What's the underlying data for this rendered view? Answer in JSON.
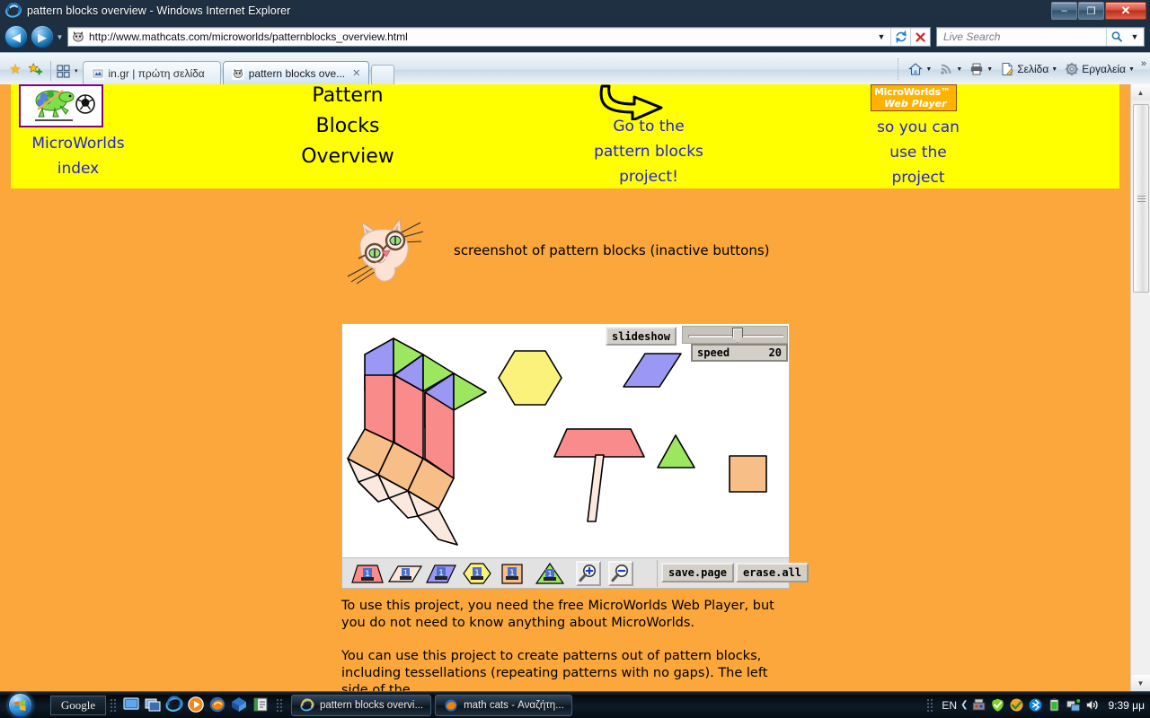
{
  "window": {
    "title": "pattern blocks overview - Windows Internet Explorer",
    "minimize_label": "–",
    "maximize_label": "❐",
    "close_label": "✕"
  },
  "navigation": {
    "back_label": "◀",
    "forward_label": "▶",
    "history_arrow": "▼",
    "url": "http://www.mathcats.com/microworlds/patternblocks_overview.html",
    "url_dropdown": "▼",
    "refresh_label": "↻",
    "stop_label": "✕",
    "search_placeholder": "Live Search",
    "search_dropdown": "▼"
  },
  "tabs": {
    "favorites_icon_label": "★",
    "add_favorite_label": "✚",
    "quicklaunch_arrow": "▾",
    "items": [
      {
        "label": "in.gr | πρώτη σελίδα",
        "active": false,
        "close": ""
      },
      {
        "label": "pattern blocks ove...",
        "active": true,
        "close": "✕"
      }
    ]
  },
  "command_bar": {
    "home": "",
    "feeds": "",
    "print": "",
    "page": "Σελίδα",
    "tools": "Εργαλεία",
    "overflow": "»",
    "arrow": "▼"
  },
  "page": {
    "background_color": "#FBA73C",
    "banner_color": "#FFFF00",
    "link_color": "#2222DD",
    "banner": {
      "index_label": "MicroWorlds\nindex",
      "index_line1": "MicroWorlds",
      "index_line2": "index",
      "title_line1": "Pattern",
      "title_line2": "Blocks",
      "title_line3": "Overview",
      "goto_line1": "Go to the",
      "goto_line2": "pattern blocks",
      "goto_line3": "project!",
      "player_logo_line1": "MicroWorlds™",
      "player_logo_line2": "Web Player",
      "soyoucan_line1": "so you can",
      "soyoucan_line2": "use the",
      "soyoucan_line3": "project"
    },
    "caption": "screenshot of pattern blocks (inactive buttons)",
    "paragraph1": "To use this project, you need the free MicroWorlds Web Player, but you do not need to know anything about MicroWorlds.",
    "paragraph2": "You can use this project to create patterns out of pattern blocks, including tessellations (repeating patterns with no gaps). The left side of the"
  },
  "app": {
    "slideshow_label": "slideshow",
    "speed_label": "speed",
    "speed_value": "20",
    "save_page_label": "save.page",
    "erase_all_label": "erase.all",
    "zoom_in_label": "+",
    "zoom_out_label": "−",
    "shape_tools": [
      {
        "name": "trapezoid-stamp",
        "color": "#F98B8B"
      },
      {
        "name": "thin-rhombus-stamp",
        "color": "#FBE6DA"
      },
      {
        "name": "rhombus-stamp",
        "color": "#9A97F5"
      },
      {
        "name": "hexagon-stamp",
        "color": "#FAF27A"
      },
      {
        "name": "square-stamp",
        "color": "#F8BE87"
      },
      {
        "name": "triangle-stamp",
        "color": "#9DE760"
      }
    ],
    "colors": {
      "red_trapezoid": "#F98B8B",
      "blue_rhombus": "#9A97F5",
      "green_triangle": "#9DE760",
      "yellow_hexagon": "#FAF27A",
      "orange_square": "#F8BE87",
      "cream_rhombus": "#FBE9E0"
    },
    "canvas_shapes": [
      {
        "name": "blue-rhombus",
        "color": "#9A97F5"
      },
      {
        "name": "green-triangle",
        "color": "#9DE760"
      },
      {
        "name": "red-trapezoid",
        "color": "#F98B8B"
      },
      {
        "name": "orange-square",
        "color": "#F8BE87"
      },
      {
        "name": "cream-rhombus",
        "color": "#FBE9E0"
      },
      {
        "name": "yellow-hexagon",
        "color": "#FAF27A"
      }
    ]
  },
  "scrollbar": {
    "up_arrow": "▲",
    "down_arrow": "▼"
  },
  "taskbar": {
    "google_label": "Google",
    "tasks": [
      {
        "label": "pattern blocks overvi...",
        "icon": "ie-icon"
      },
      {
        "label": "math cats - Αναζήτη...",
        "icon": "firefox-icon"
      }
    ],
    "language": "EN",
    "tray_chevron": "❮",
    "clock": "9:39 μμ"
  }
}
